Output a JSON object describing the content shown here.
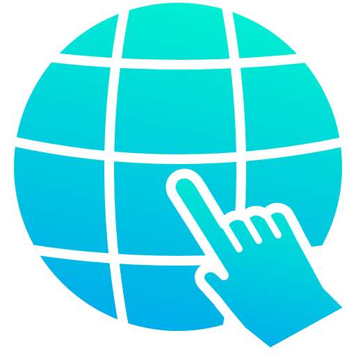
{
  "icon": {
    "name": "globe-click-icon",
    "parts": [
      "globe-icon",
      "pointing-hand-icon"
    ]
  },
  "colors": {
    "gradient_top": "#00efd1",
    "gradient_bottom": "#00acea",
    "lines": "#ffffff",
    "background": "#ffffff"
  }
}
